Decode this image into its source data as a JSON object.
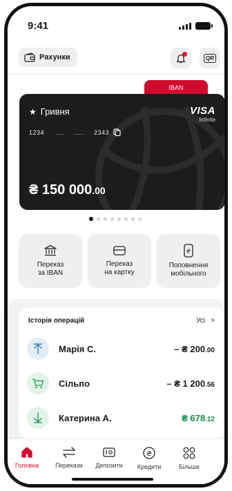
{
  "status_bar": {
    "time": "9:41"
  },
  "header": {
    "accounts_label": "Рахунки",
    "qr_label": "QR"
  },
  "card": {
    "tab_label": "IBAN",
    "currency": "Гривня",
    "number_start": "1234",
    "number_mask_1": "....",
    "number_mask_2": "....",
    "number_end": "2343",
    "brand": "VISA",
    "tier": "Infinite",
    "balance_main": "₴ 150 000",
    "balance_cents": ".00"
  },
  "carousel": {
    "count": 8,
    "active_index": 0
  },
  "actions": [
    {
      "line1": "Переказ",
      "line2": "за IBAN",
      "icon": "bank-icon"
    },
    {
      "line1": "Переказ",
      "line2": "на картку",
      "icon": "card-icon"
    },
    {
      "line1": "Поповнення",
      "line2": "мобільного",
      "icon": "phone-hryvnia-icon"
    }
  ],
  "history": {
    "title": "Історія операцій",
    "all_label": "Усі",
    "operations": [
      {
        "name": "Марія С.",
        "amount_main": "– ₴ 200",
        "amount_cents": ".00",
        "type": "outgoing",
        "icon": "arrow-up-icon",
        "color": "#2a7bb5",
        "bg": "#e3edf5"
      },
      {
        "name": "Сільпо",
        "amount_main": "– ₴ 1 200",
        "amount_cents": ".56",
        "type": "purchase",
        "icon": "cart-icon",
        "color": "#1a9a4e",
        "bg": "#e2f3e8"
      },
      {
        "name": "Катерина А.",
        "amount_main": "₴ 678",
        "amount_cents": ".12",
        "type": "incoming",
        "icon": "arrow-down-icon",
        "color": "#1a9a4e",
        "bg": "#e2f3e8"
      }
    ]
  },
  "nav": [
    {
      "label": "Головна",
      "icon": "home-icon",
      "active": true
    },
    {
      "label": "Перекази",
      "icon": "transfer-icon",
      "active": false
    },
    {
      "label": "Депозити",
      "icon": "deposit-icon",
      "active": false
    },
    {
      "label": "Кредити",
      "icon": "credit-icon",
      "active": false
    },
    {
      "label": "Більше",
      "icon": "more-icon",
      "active": false
    }
  ],
  "colors": {
    "accent": "#d20a2e",
    "card_bg": "#1c1c1c",
    "income": "#178a4a"
  }
}
